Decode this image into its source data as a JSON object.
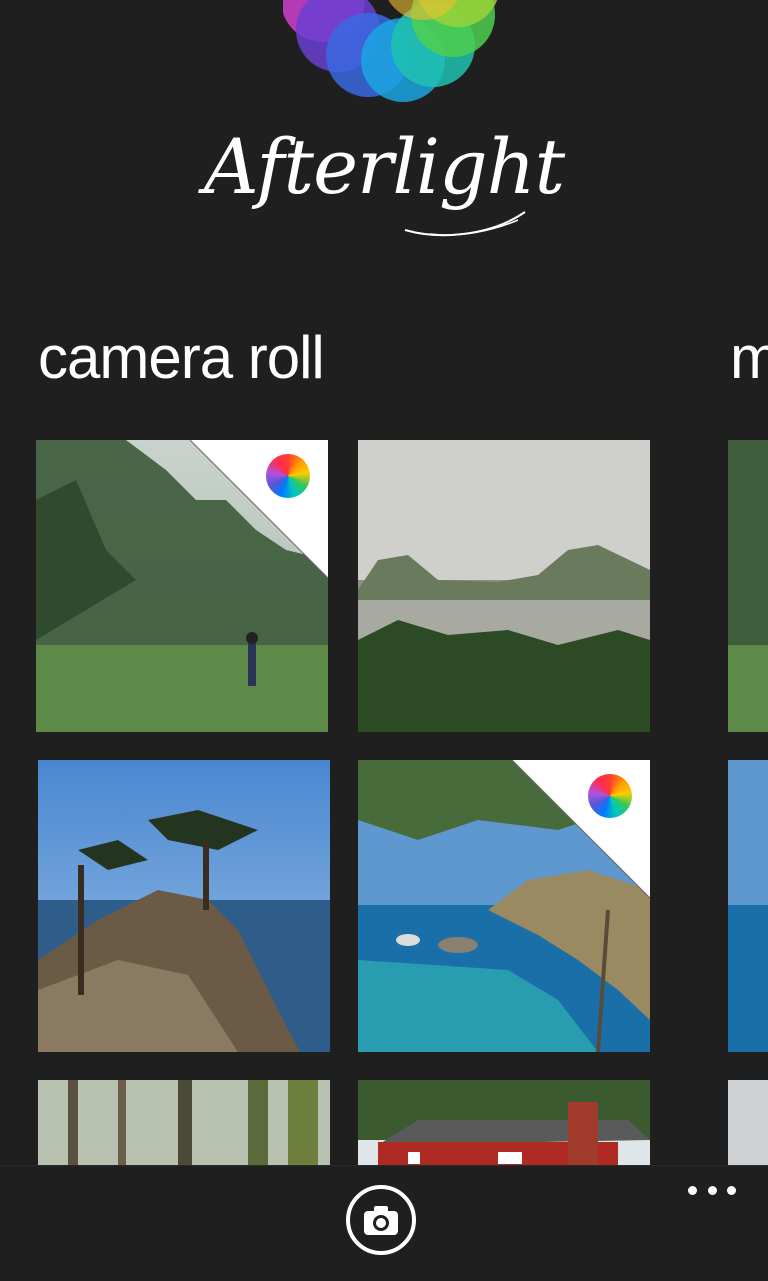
{
  "app": {
    "logo_text": "Afterlight"
  },
  "sections": {
    "primary_title": "camera roll",
    "next_title": "m"
  },
  "gallery": {
    "tiles": [
      {
        "subject": "forest meadow with figure",
        "edited": true
      },
      {
        "subject": "misty lake",
        "edited": false
      },
      {
        "subject": "lone cypress on rocks",
        "edited": false
      },
      {
        "subject": "coastal cove with eucalyptus",
        "edited": true
      },
      {
        "subject": "mossy forest",
        "edited": false
      },
      {
        "subject": "red house",
        "edited": false
      }
    ]
  },
  "app_bar": {
    "primary_action": "camera-icon",
    "overflow": "more-icon"
  },
  "colors": {
    "background": "#1f1f1f",
    "text": "#ffffff"
  }
}
